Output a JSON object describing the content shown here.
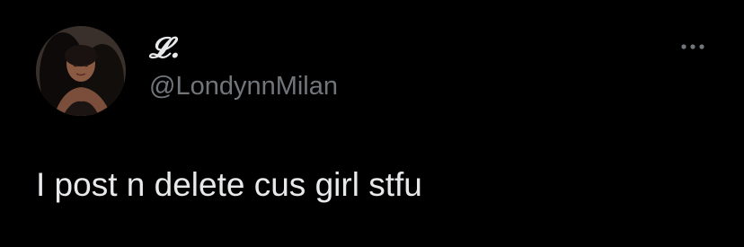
{
  "tweet": {
    "author": {
      "display_name": "𝓛.",
      "handle": "@LondynnMilan",
      "avatar_icon": "profile-photo"
    },
    "more_icon": "more-options-icon",
    "text": "I post n delete cus girl stfu"
  },
  "colors": {
    "background": "#000000",
    "primary_text": "#e7e9ea",
    "secondary_text": "#71767b"
  }
}
